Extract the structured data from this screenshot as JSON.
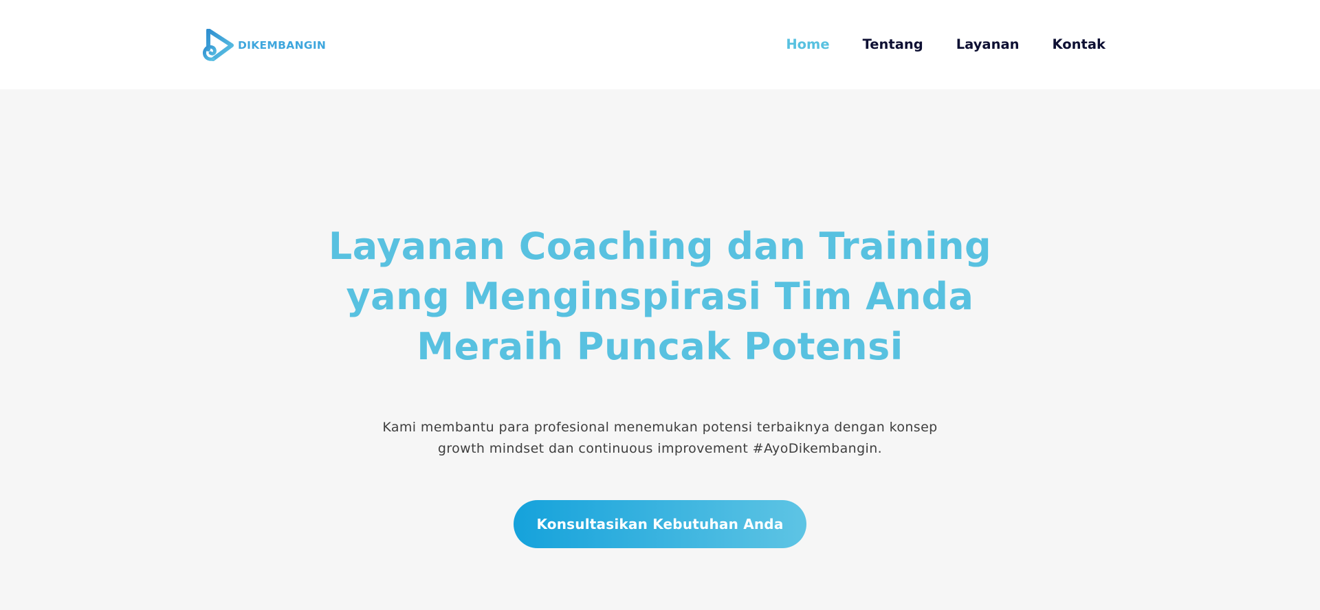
{
  "brand": {
    "name": "DIKEMBANGIN",
    "logo_icon": "play-swirl-logo-icon",
    "color": "#3ea6dd"
  },
  "nav": {
    "items": [
      {
        "label": "Home",
        "active": true
      },
      {
        "label": "Tentang",
        "active": false
      },
      {
        "label": "Layanan",
        "active": false
      },
      {
        "label": "Kontak",
        "active": false
      }
    ],
    "active_color": "#58c1e0",
    "text_color": "#0e1033"
  },
  "hero": {
    "title_lines": [
      "Layanan Coaching dan Training",
      "yang Menginspirasi Tim Anda",
      "Meraih Puncak Potensi"
    ],
    "subtitle_lines": [
      "Kami membantu para profesional menemukan potensi terbaiknya dengan konsep",
      "growth mindset dan continuous improvement #AyoDikembangin."
    ],
    "cta_label": "Konsultasikan Kebutuhan Anda",
    "title_color": "#58c1e0",
    "background": "#f6f6f6"
  }
}
